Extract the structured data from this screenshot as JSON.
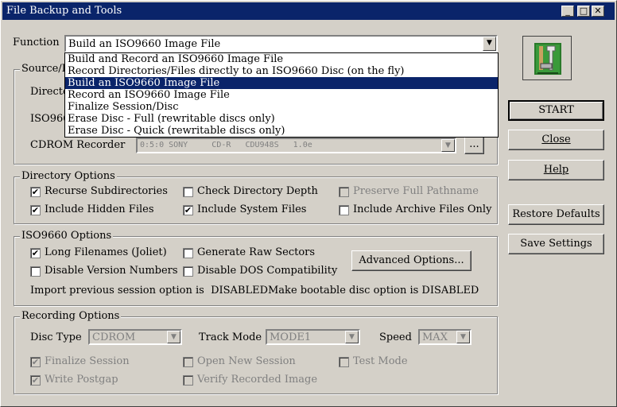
{
  "window": {
    "title": "File Backup and Tools"
  },
  "function": {
    "label": "Function",
    "selected": "Build an ISO9660 Image File",
    "options": [
      "Build and Record an ISO9660 Image File",
      "Record Directories/Files directly to an ISO9660 Disc (on the fly)",
      "Build an ISO9660 Image File",
      "Record an ISO9660 Image File",
      "Finalize Session/Disc",
      "Erase Disc - Full (rewritable discs only)",
      "Erase Disc - Quick (rewritable discs only)"
    ]
  },
  "source": {
    "group_title": "Source/D",
    "directory_label": "Directo",
    "iso_label": "ISO966",
    "cdrom_label": "CDROM Recorder",
    "cdrom_value": "0:5:0 SONY     CD-R   CDU948S   1.0e",
    "browse_label": "..."
  },
  "directory_options": {
    "title": "Directory Options",
    "recurse": "Recurse Subdirectories",
    "check_depth": "Check Directory Depth",
    "preserve": "Preserve Full Pathname",
    "hidden": "Include Hidden Files",
    "system": "Include System Files",
    "archive": "Include Archive Files Only"
  },
  "iso_options": {
    "title": "ISO9660 Options",
    "joliet": "Long Filenames (Joliet)",
    "raw": "Generate Raw Sectors",
    "version": "Disable Version Numbers",
    "dos": "Disable DOS Compatibility",
    "advanced": "Advanced Options...",
    "import_text": "Import previous session option is  DISABLED",
    "boot_text": "Make bootable disc option is DISABLED"
  },
  "recording": {
    "title": "Recording Options",
    "disc_type_label": "Disc Type",
    "disc_type_value": "CDROM",
    "track_mode_label": "Track Mode",
    "track_mode_value": "MODE1",
    "speed_label": "Speed",
    "speed_value": "MAX",
    "finalize": "Finalize Session",
    "open_new": "Open New Session",
    "test_mode": "Test Mode",
    "write_postgap": "Write Postgap",
    "verify": "Verify Recorded Image"
  },
  "buttons": {
    "start": "START",
    "close": "Close",
    "help": "Help",
    "restore": "Restore Defaults",
    "save": "Save Settings"
  },
  "icons": {
    "tools": "tools-icon",
    "minimize": "minimize-icon",
    "maximize": "maximize-icon",
    "close": "close-icon",
    "dropdown": "chevron-down-icon"
  },
  "colors": {
    "titlebar": "#0a246a",
    "face": "#d4d0c8",
    "selection": "#0a246a"
  }
}
